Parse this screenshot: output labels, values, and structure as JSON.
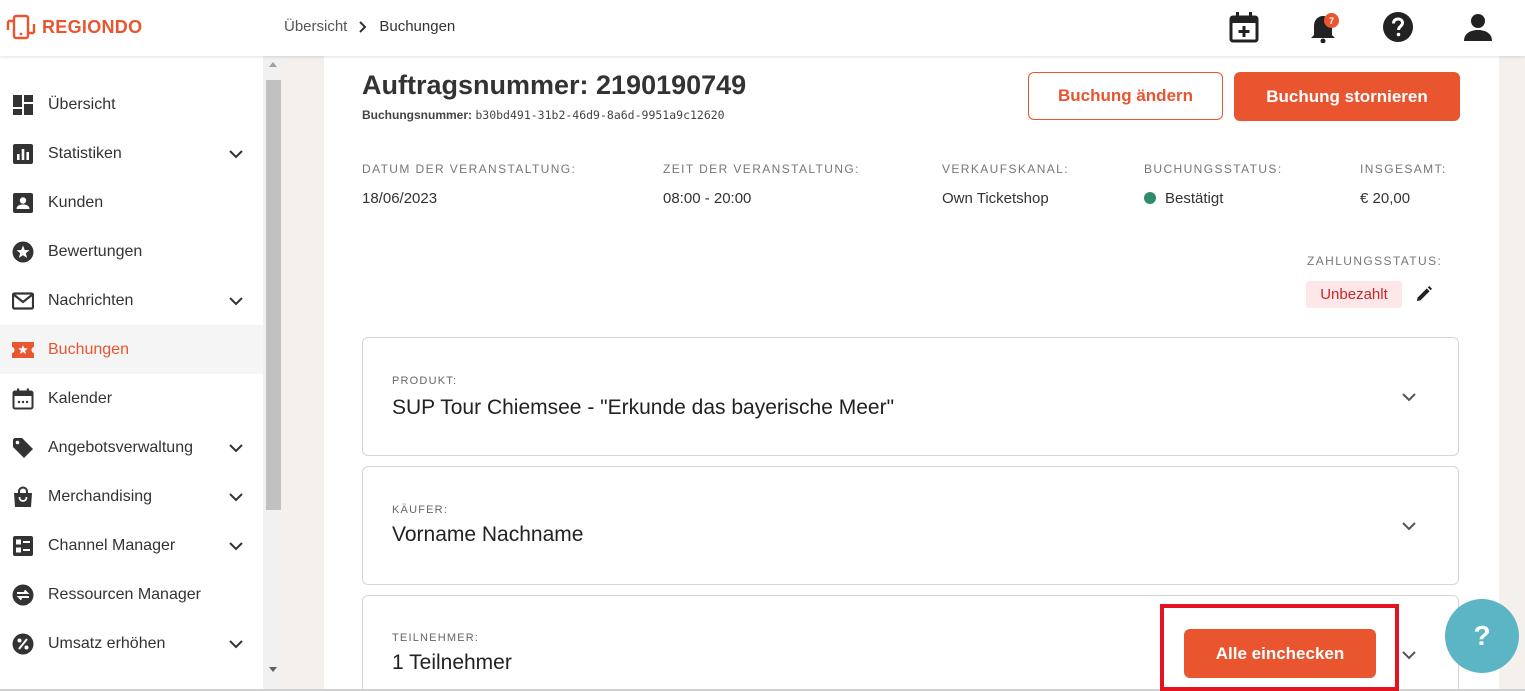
{
  "brand": {
    "name": "REGIONDO",
    "accent": "#e8552f"
  },
  "breadcrumb": {
    "home": "Übersicht",
    "current": "Buchungen"
  },
  "topbar": {
    "icons": [
      "calendar-add-icon",
      "bell-icon",
      "help-icon",
      "user-icon"
    ],
    "notification_count": "7"
  },
  "sidebar": {
    "items": [
      {
        "label": "Übersicht",
        "icon": "dashboard-icon",
        "expandable": false
      },
      {
        "label": "Statistiken",
        "icon": "bar-chart-icon",
        "expandable": true
      },
      {
        "label": "Kunden",
        "icon": "contact-card-icon",
        "expandable": false
      },
      {
        "label": "Bewertungen",
        "icon": "star-icon",
        "expandable": false
      },
      {
        "label": "Nachrichten",
        "icon": "mail-icon",
        "expandable": true
      },
      {
        "label": "Buchungen",
        "icon": "ticket-icon",
        "expandable": false,
        "active": true
      },
      {
        "label": "Kalender",
        "icon": "calendar-icon",
        "expandable": false
      },
      {
        "label": "Angebotsverwaltung",
        "icon": "tag-icon",
        "expandable": true
      },
      {
        "label": "Merchandising",
        "icon": "shopping-bag-icon",
        "expandable": true
      },
      {
        "label": "Channel Manager",
        "icon": "channel-icon",
        "expandable": true
      },
      {
        "label": "Ressourcen Manager",
        "icon": "swap-icon",
        "expandable": false
      },
      {
        "label": "Umsatz erhöhen",
        "icon": "percent-icon",
        "expandable": true
      }
    ]
  },
  "order": {
    "title": "Auftragsnummer: 2190190749",
    "booking_label": "Buchungsnummer:",
    "booking_id": "b30bd491-31b2-46d9-8a6d-9951a9c12620",
    "edit_button": "Buchung ändern",
    "cancel_button": "Buchung stornieren"
  },
  "info": {
    "date_label": "DATUM DER VERANSTALTUNG:",
    "date_value": "18/06/2023",
    "time_label": "ZEIT DER VERANSTALTUNG:",
    "time_value": "08:00 - 20:00",
    "channel_label": "VERKAUFSKANAL:",
    "channel_value": "Own Ticketshop",
    "status_label": "BUCHUNGSSTATUS:",
    "status_value": "Bestätigt",
    "status_color": "#2e8b6e",
    "total_label": "INSGESAMT:",
    "total_value": "€ 20,00",
    "payment_label": "ZAHLUNGSSTATUS:",
    "payment_value": "Unbezahlt"
  },
  "panels": {
    "product_label": "PRODUKT:",
    "product_value": "SUP Tour Chiemsee - \"Erkunde das bayerische Meer\"",
    "buyer_label": "KÄUFER:",
    "buyer_value": "Vorname Nachname",
    "participants_label": "TEILNEHMER:",
    "participants_value": "1 Teilnehmer",
    "checkin_button": "Alle einchecken"
  },
  "help_fab": "?"
}
